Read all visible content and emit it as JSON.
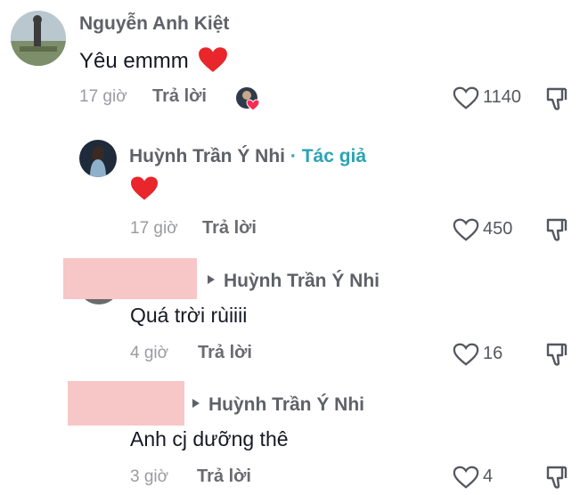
{
  "comments": [
    {
      "author": "Nguyễn Anh Kiệt",
      "text": "Yêu emmm",
      "emoji": "❤️",
      "time": "17 giờ",
      "reply_label": "Trả lời",
      "likes": "1140"
    },
    {
      "author": "Huỳnh Trần Ý Nhi",
      "separator": "·",
      "badge": "Tác giả",
      "emoji": "❤️",
      "time": "17 giờ",
      "reply_label": "Trả lời",
      "likes": "450"
    },
    {
      "mention": "Huỳnh Trần Ý Nhi",
      "text": "Quá trời rùiiii",
      "time": "4 giờ",
      "reply_label": "Trả lời",
      "likes": "16"
    },
    {
      "mention": "Huỳnh Trần Ý Nhi",
      "text": "Anh cj dưỡng thê",
      "time": "3 giờ",
      "reply_label": "Trả lời",
      "likes": "4"
    }
  ],
  "colors": {
    "heart": "#e8262b",
    "badge": "#2aa3b5",
    "redaction": "#f7c6c6"
  },
  "icons": [
    "heart-outline-icon",
    "dislike-icon",
    "heart-emoji",
    "creator-liked-avatar-icon"
  ]
}
